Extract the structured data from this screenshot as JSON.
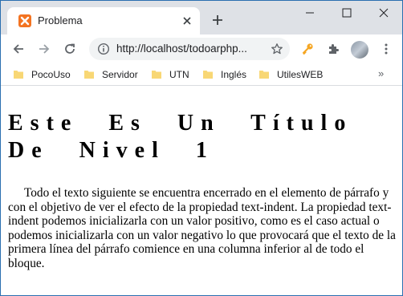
{
  "tab": {
    "title": "Problema"
  },
  "address_bar": {
    "url": "http://localhost/todoarphp..."
  },
  "bookmarks": [
    "PocoUso",
    "Servidor",
    "UTN",
    "Inglés",
    "UtilesWEB"
  ],
  "page": {
    "heading": "Este Es Un Título De Nivel 1",
    "paragraph": "Todo el texto siguiente se encuentra encerrado en el elemento de párrafo y con el objetivo de ver el efecto de la propiedad text-indent. La propiedad text-indent podemos inicializarla con un valor positivo, como es el caso actual o podemos inicializarla con un valor negativo lo que provocará que el texto de la primera línea del párrafo comience en una columna inferior al de todo el bloque."
  },
  "colors": {
    "tabstrip": "#dee1e6",
    "favicon": "#f37321",
    "extension_key": "#f5a623"
  },
  "icons": [
    "xampp-favicon",
    "close-icon",
    "plus-icon",
    "minimize-icon",
    "maximize-icon",
    "window-close-icon",
    "back-arrow-icon",
    "forward-arrow-icon",
    "reload-icon",
    "info-icon",
    "star-icon",
    "key-icon",
    "puzzle-icon",
    "avatar",
    "kebab-menu-icon",
    "folder-icon",
    "chevron-double-right-icon"
  ]
}
